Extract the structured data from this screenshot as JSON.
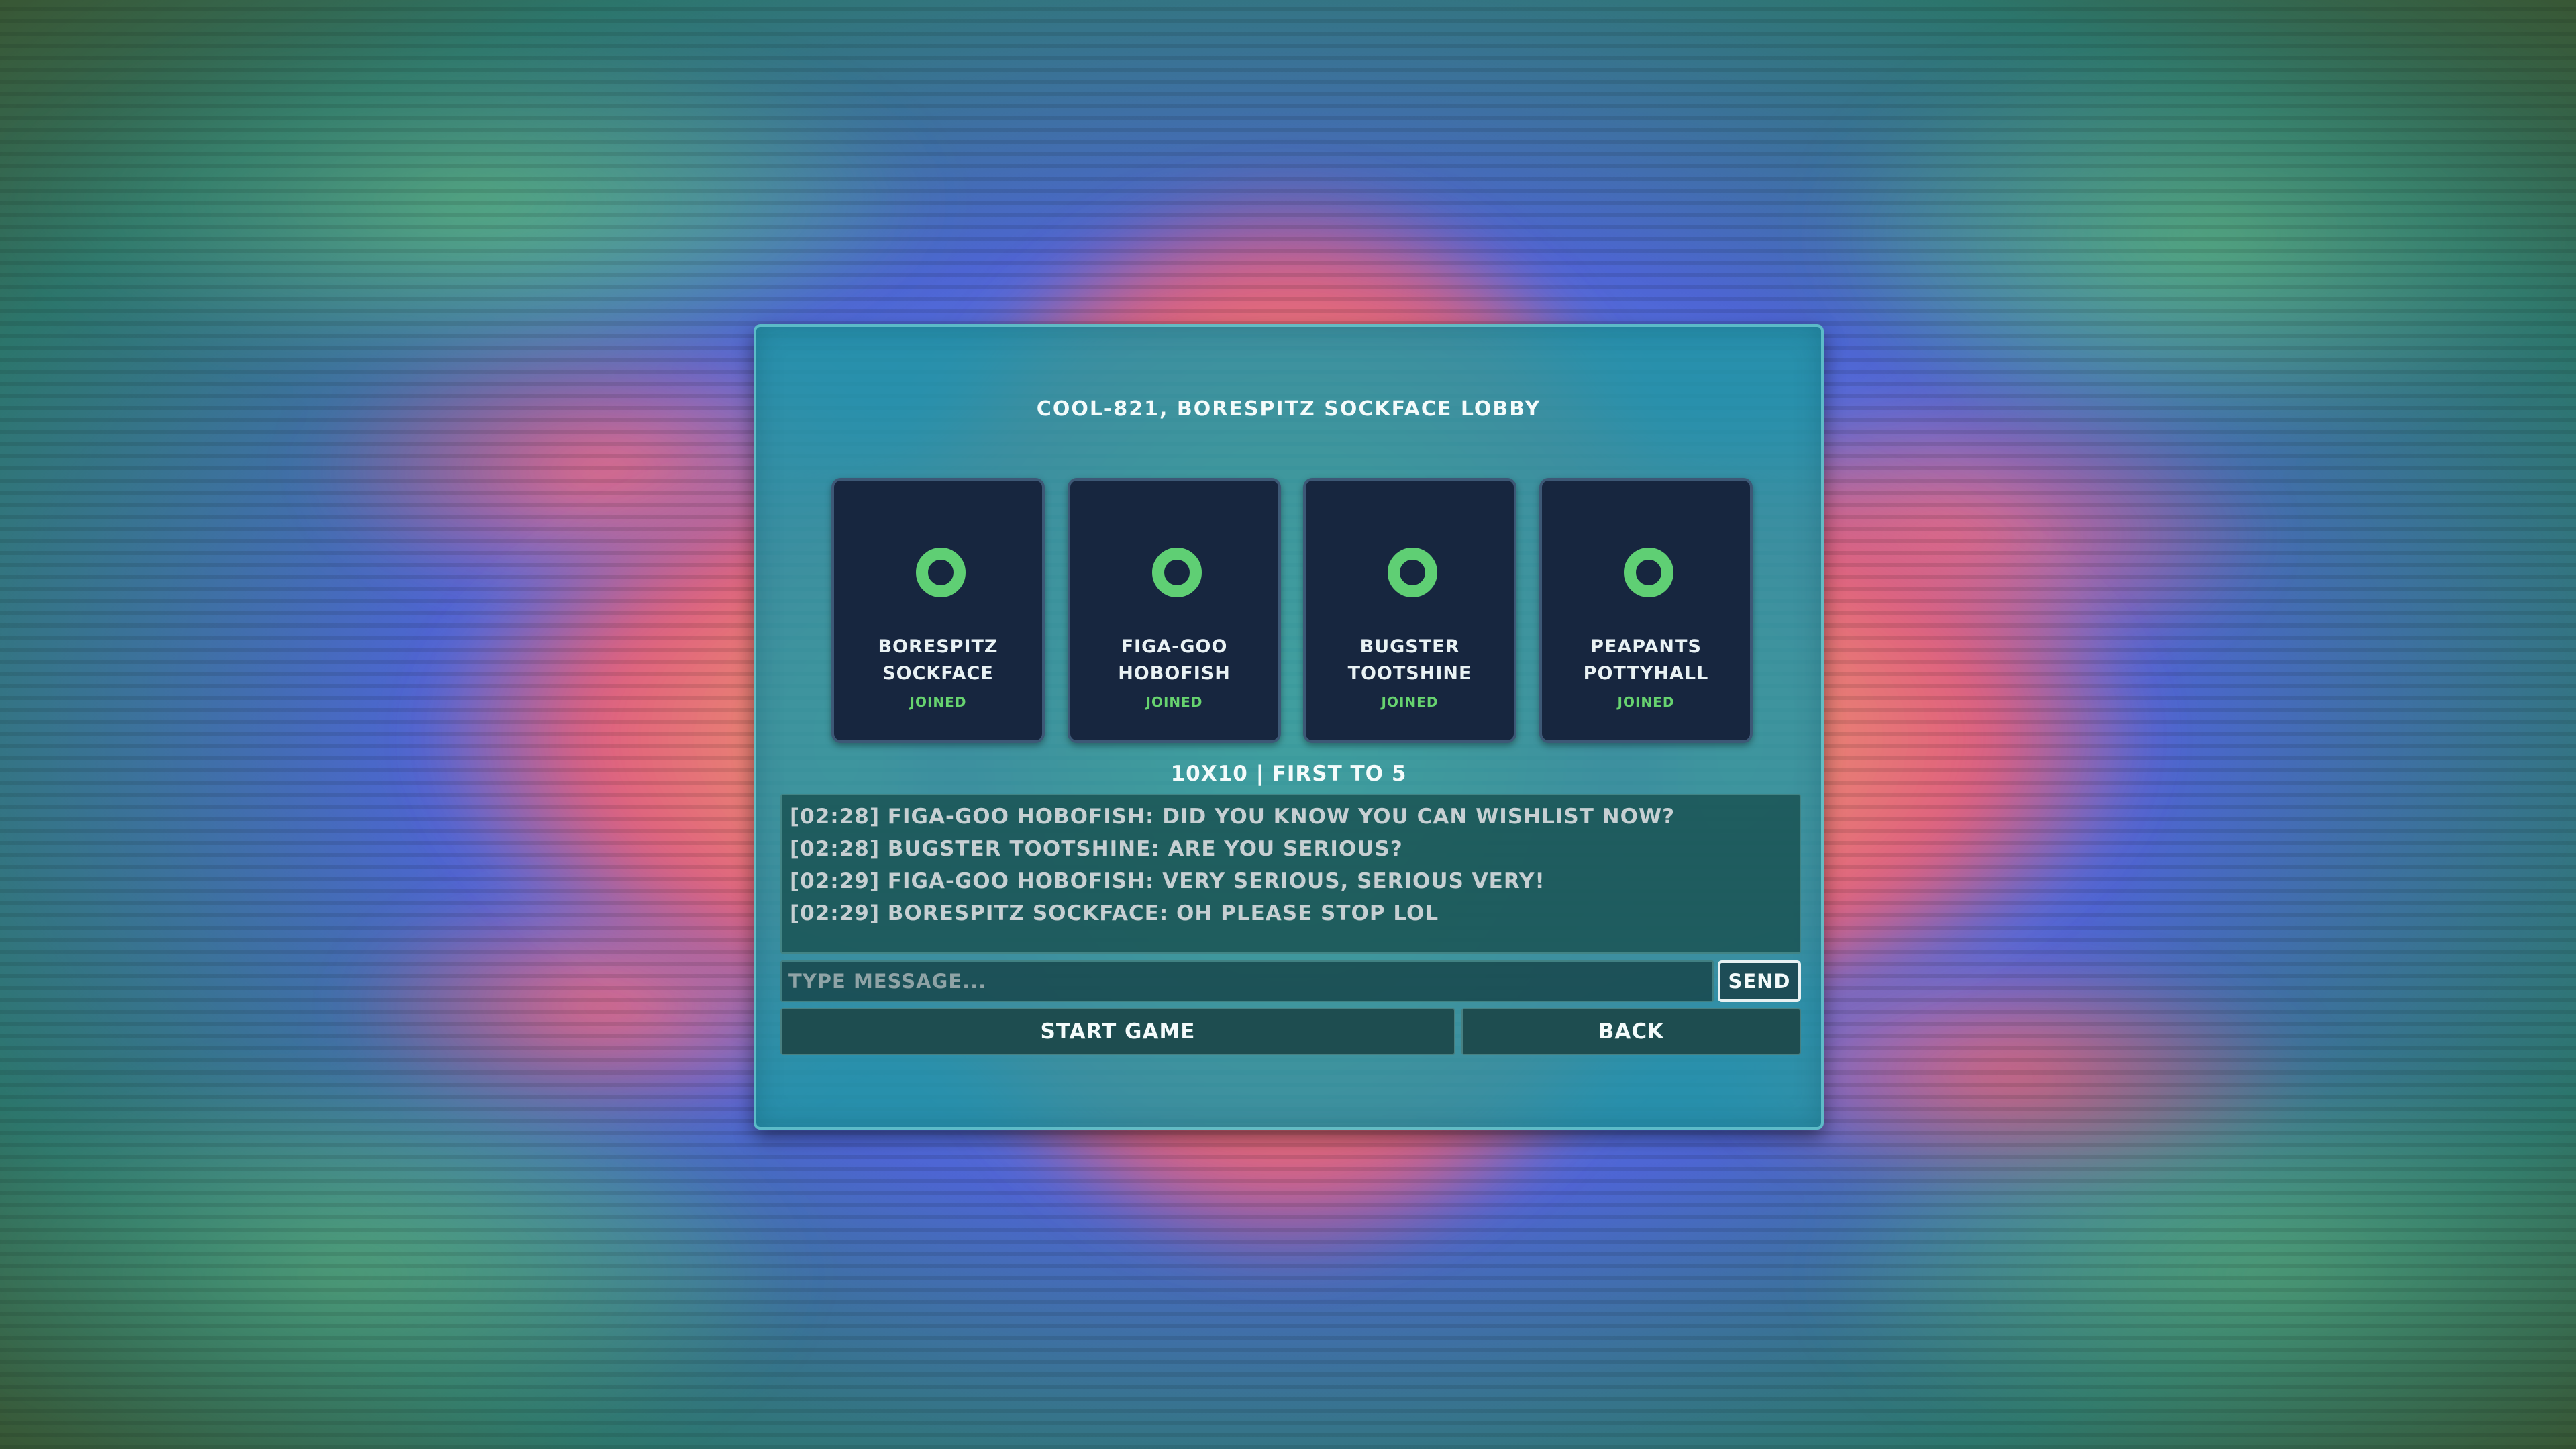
{
  "lobby": {
    "title": "COOL-821, BORESPITZ SOCKFACE LOBBY",
    "settings": "10X10 | FIRST TO 5"
  },
  "players": [
    {
      "name_line1": "BORESPITZ",
      "name_line2": "SOCKFACE",
      "status": "JOINED",
      "icon": "green-ring-icon"
    },
    {
      "name_line1": "FIGA-GOO",
      "name_line2": "HOBOFISH",
      "status": "JOINED",
      "icon": "green-ring-icon"
    },
    {
      "name_line1": "BUGSTER",
      "name_line2": "TOOTSHINE",
      "status": "JOINED",
      "icon": "green-ring-icon"
    },
    {
      "name_line1": "PEAPANTS",
      "name_line2": "POTTYHALL",
      "status": "JOINED",
      "icon": "green-ring-icon"
    }
  ],
  "chat": {
    "messages": [
      "[02:28] FIGA-GOO HOBOFISH: DID YOU KNOW YOU CAN WISHLIST NOW?",
      "[02:28] BUGSTER TOOTSHINE: ARE YOU SERIOUS?",
      "[02:29] FIGA-GOO HOBOFISH: VERY SERIOUS, SERIOUS VERY!",
      "[02:29] BORESPITZ SOCKFACE: OH PLEASE STOP LOL"
    ],
    "input_value": "",
    "input_placeholder": "TYPE MESSAGE...",
    "send_label": "SEND"
  },
  "actions": {
    "start_label": "START GAME",
    "back_label": "BACK"
  },
  "colors": {
    "accent_green": "#5fcf74",
    "panel": "#2296a5",
    "card": "#17263f"
  }
}
